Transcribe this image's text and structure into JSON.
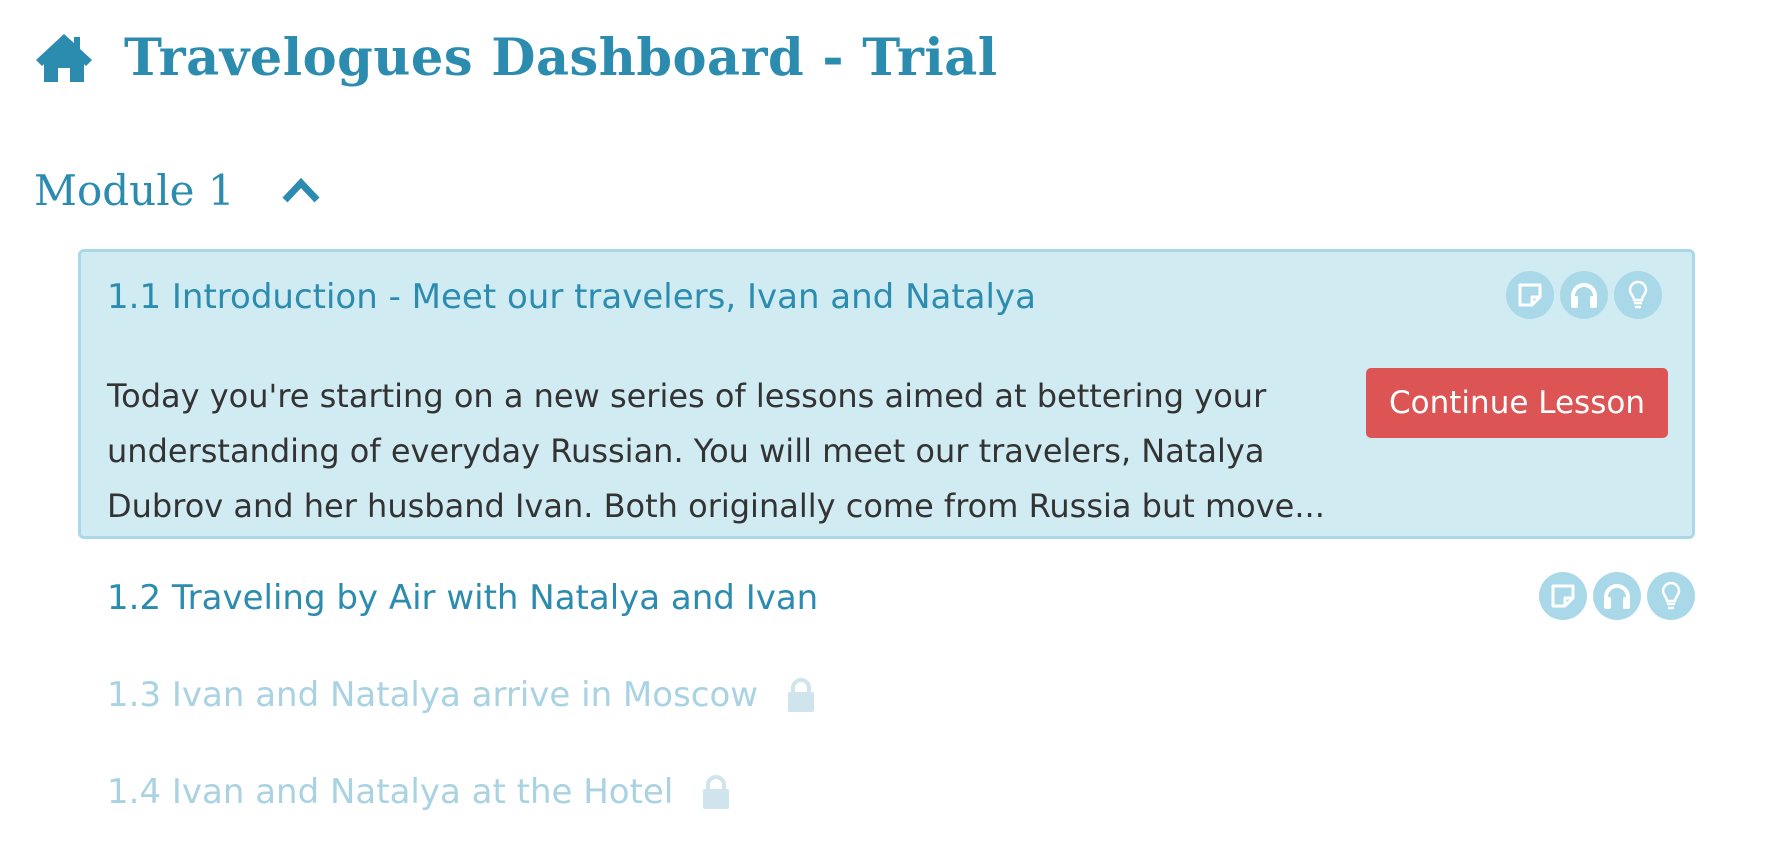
{
  "header": {
    "title": "Travelogues Dashboard - Trial",
    "icon": "home-icon"
  },
  "module": {
    "title": "Module 1",
    "toggle_icon": "chevron-up-icon",
    "expanded": true
  },
  "lessons": [
    {
      "title": "1.1 Introduction - Meet our travelers, Ivan and Natalya",
      "description": "Today you're starting on a new series of lessons aimed at bettering your understanding of everyday Russian. You will meet our travelers, Natalya Dubrov and her husband Ivan. Both originally come from Russia but move...",
      "button_label": "Continue Lesson",
      "icons": [
        "note-icon",
        "headphones-icon",
        "lightbulb-icon"
      ],
      "locked": false,
      "active": true
    },
    {
      "title": "1.2 Traveling by Air with Natalya and Ivan",
      "icons": [
        "note-icon",
        "headphones-icon",
        "lightbulb-icon"
      ],
      "locked": false
    },
    {
      "title": "1.3 Ivan and Natalya arrive in Moscow",
      "locked": true,
      "icons": [
        "lock-icon"
      ]
    },
    {
      "title": "1.4 Ivan and Natalya at the Hotel",
      "locked": true,
      "icons": [
        "lock-icon"
      ]
    }
  ],
  "colors": {
    "primary": "#2b8cb0",
    "card_background": "#d1ebf3",
    "card_border": "#a9d8e8",
    "icon_circle": "#a9d8e8",
    "locked_text": "#a9d2e2",
    "button": "#dc5454",
    "body_text": "#333333"
  }
}
